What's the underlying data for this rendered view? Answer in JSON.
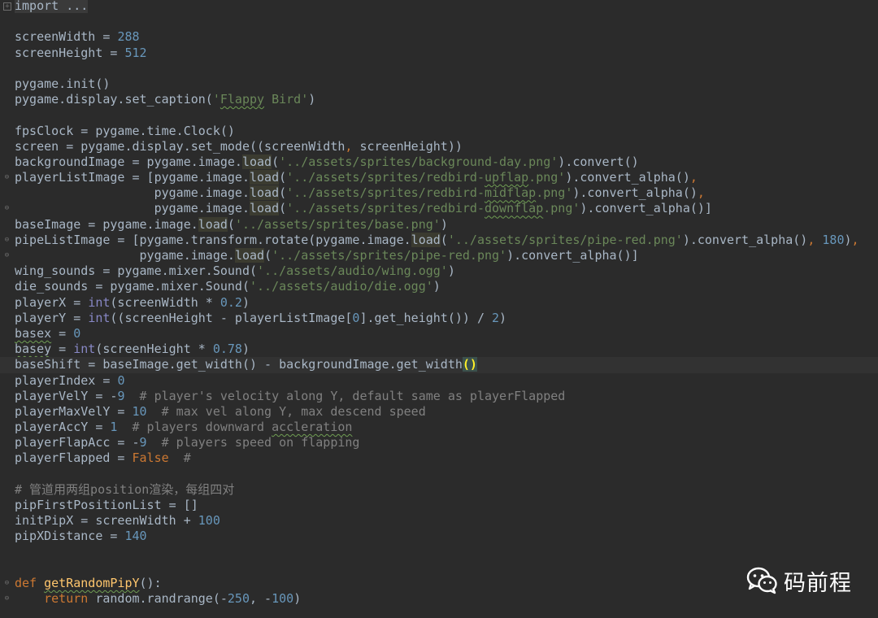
{
  "editor": {
    "theme_colors": {
      "background": "#2b2b2b",
      "number": "#6897bb",
      "string": "#6a8759",
      "keyword": "#cc7832",
      "comment": "#808080",
      "builtin": "#8888c6",
      "function_def": "#ffc66d",
      "text": "#a9b7c6"
    },
    "lines": [
      [
        {
          "t": "import ...",
          "c": "fold-text"
        }
      ],
      [],
      [
        {
          "t": "screenWidth = "
        },
        {
          "t": "288",
          "c": "n"
        }
      ],
      [
        {
          "t": "screenHeight = "
        },
        {
          "t": "512",
          "c": "n"
        }
      ],
      [],
      [
        {
          "t": "pygame.init()"
        }
      ],
      [
        {
          "t": "pygame.display.set_caption("
        },
        {
          "t": "'",
          "c": "s"
        },
        {
          "t": "Flappy",
          "c": "s typo"
        },
        {
          "t": " Bird'",
          "c": "s"
        },
        {
          "t": ")"
        }
      ],
      [],
      [
        {
          "t": "fpsClock = pygame.time.Clock()"
        }
      ],
      [
        {
          "t": "screen = pygame.display.set_mode((screenWidth"
        },
        {
          "t": ",",
          "c": "k"
        },
        {
          "t": " screenHeight))"
        }
      ],
      [
        {
          "t": "backgroundImage = pygame.image."
        },
        {
          "t": "load",
          "c": "hl"
        },
        {
          "t": "("
        },
        {
          "t": "'../assets/sprites/background-day.png'",
          "c": "s"
        },
        {
          "t": ").convert()"
        }
      ],
      [
        {
          "t": "playerListImage = [pygame.image."
        },
        {
          "t": "load",
          "c": "hl"
        },
        {
          "t": "("
        },
        {
          "t": "'../assets/sprites/redbird-",
          "c": "s"
        },
        {
          "t": "upflap",
          "c": "s typo"
        },
        {
          "t": ".png'",
          "c": "s"
        },
        {
          "t": ").convert_alpha()"
        },
        {
          "t": ",",
          "c": "k"
        }
      ],
      [
        {
          "t": "                   pygame.image."
        },
        {
          "t": "load",
          "c": "hl"
        },
        {
          "t": "("
        },
        {
          "t": "'../assets/sprites/redbird-",
          "c": "s"
        },
        {
          "t": "midflap",
          "c": "s typo"
        },
        {
          "t": ".png'",
          "c": "s"
        },
        {
          "t": ").convert_alpha()"
        },
        {
          "t": ",",
          "c": "k"
        }
      ],
      [
        {
          "t": "                   pygame.image."
        },
        {
          "t": "load",
          "c": "hl"
        },
        {
          "t": "("
        },
        {
          "t": "'../assets/sprites/redbird-",
          "c": "s"
        },
        {
          "t": "downflap",
          "c": "s typo"
        },
        {
          "t": ".png'",
          "c": "s"
        },
        {
          "t": ").convert_alpha()]"
        }
      ],
      [
        {
          "t": "baseImage = pygame.image."
        },
        {
          "t": "load",
          "c": "hl"
        },
        {
          "t": "("
        },
        {
          "t": "'../assets/sprites/base.png'",
          "c": "s"
        },
        {
          "t": ")"
        }
      ],
      [
        {
          "t": "pipeListImage = [pygame.transform.rotate(pygame.image."
        },
        {
          "t": "load",
          "c": "hl"
        },
        {
          "t": "("
        },
        {
          "t": "'../assets/sprites/pipe-red.png'",
          "c": "s"
        },
        {
          "t": ").convert_alpha()"
        },
        {
          "t": ",",
          "c": "k"
        },
        {
          "t": " "
        },
        {
          "t": "180",
          "c": "n"
        },
        {
          "t": ")"
        },
        {
          "t": ",",
          "c": "k"
        }
      ],
      [
        {
          "t": "                 pygame.image."
        },
        {
          "t": "load",
          "c": "hl"
        },
        {
          "t": "("
        },
        {
          "t": "'../assets/sprites/pipe-red.png'",
          "c": "s"
        },
        {
          "t": ").convert_alpha()]"
        }
      ],
      [
        {
          "t": "wing_sounds = pygame.mixer.Sound("
        },
        {
          "t": "'../assets/audio/wing.ogg'",
          "c": "s"
        },
        {
          "t": ")"
        }
      ],
      [
        {
          "t": "die_sounds = pygame.mixer.Sound("
        },
        {
          "t": "'../assets/audio/die.ogg'",
          "c": "s"
        },
        {
          "t": ")"
        }
      ],
      [
        {
          "t": "playerX = "
        },
        {
          "t": "int",
          "c": "b"
        },
        {
          "t": "(screenWidth * "
        },
        {
          "t": "0.2",
          "c": "n"
        },
        {
          "t": ")"
        }
      ],
      [
        {
          "t": "playerY = "
        },
        {
          "t": "int",
          "c": "b"
        },
        {
          "t": "((screenHeight - playerListImage["
        },
        {
          "t": "0",
          "c": "n"
        },
        {
          "t": "].get_height()) / "
        },
        {
          "t": "2",
          "c": "n"
        },
        {
          "t": ")"
        }
      ],
      [
        {
          "t": "basex",
          "c": "typo-n"
        },
        {
          "t": " = "
        },
        {
          "t": "0",
          "c": "n"
        }
      ],
      [
        {
          "t": "basey",
          "c": "typo-n"
        },
        {
          "t": " = "
        },
        {
          "t": "int",
          "c": "b"
        },
        {
          "t": "(screenHeight * "
        },
        {
          "t": "0.78",
          "c": "n"
        },
        {
          "t": ")"
        }
      ],
      [
        {
          "t": "baseShift = baseImage.get_width() - backgroundImage.get_width"
        },
        {
          "t": "()",
          "c": "bm"
        }
      ],
      [
        {
          "t": "playerIndex = "
        },
        {
          "t": "0",
          "c": "n"
        }
      ],
      [
        {
          "t": "playerVelY = -"
        },
        {
          "t": "9",
          "c": "n"
        },
        {
          "t": "  "
        },
        {
          "t": "# player's velocity along Y, default same as playerFlapped",
          "c": "c"
        }
      ],
      [
        {
          "t": "playerMaxVelY = "
        },
        {
          "t": "10",
          "c": "n"
        },
        {
          "t": "  "
        },
        {
          "t": "# max vel along Y, max descend speed",
          "c": "c"
        }
      ],
      [
        {
          "t": "playerAccY = "
        },
        {
          "t": "1",
          "c": "n"
        },
        {
          "t": "  "
        },
        {
          "t": "# players downward ",
          "c": "c"
        },
        {
          "t": "accleration",
          "c": "c typo"
        }
      ],
      [
        {
          "t": "playerFlapAcc = -"
        },
        {
          "t": "9",
          "c": "n"
        },
        {
          "t": "  "
        },
        {
          "t": "# players speed on flapping",
          "c": "c"
        }
      ],
      [
        {
          "t": "playerFlapped = "
        },
        {
          "t": "False",
          "c": "k"
        },
        {
          "t": "  "
        },
        {
          "t": "#",
          "c": "c"
        }
      ],
      [],
      [
        {
          "t": "# 管道用两组position渲染，每组四对",
          "c": "c"
        }
      ],
      [
        {
          "t": "pipFirstPositionList = []"
        }
      ],
      [
        {
          "t": "initPipX = screenWidth + "
        },
        {
          "t": "100",
          "c": "n"
        }
      ],
      [
        {
          "t": "pipXDistance = "
        },
        {
          "t": "140",
          "c": "n"
        }
      ],
      [],
      [],
      [
        {
          "t": "def",
          "c": "k"
        },
        {
          "t": " "
        },
        {
          "t": "getRandomPipY",
          "c": "f typo"
        },
        {
          "t": "():"
        }
      ],
      [
        {
          "t": "    "
        },
        {
          "t": "return",
          "c": "k"
        },
        {
          "t": " random.randrange(-"
        },
        {
          "t": "250",
          "c": "n"
        },
        {
          "t": ","
        },
        {
          "t": " -"
        },
        {
          "t": "100",
          "c": "n"
        },
        {
          "t": ")"
        }
      ]
    ],
    "current_line": 23,
    "fold_markers": {
      "0": "box-plus",
      "11": "open",
      "13": "close",
      "15": "open",
      "16": "close",
      "37": "open",
      "38": "close"
    }
  },
  "watermark": {
    "icon": "wechat-icon",
    "text": "码前程"
  }
}
